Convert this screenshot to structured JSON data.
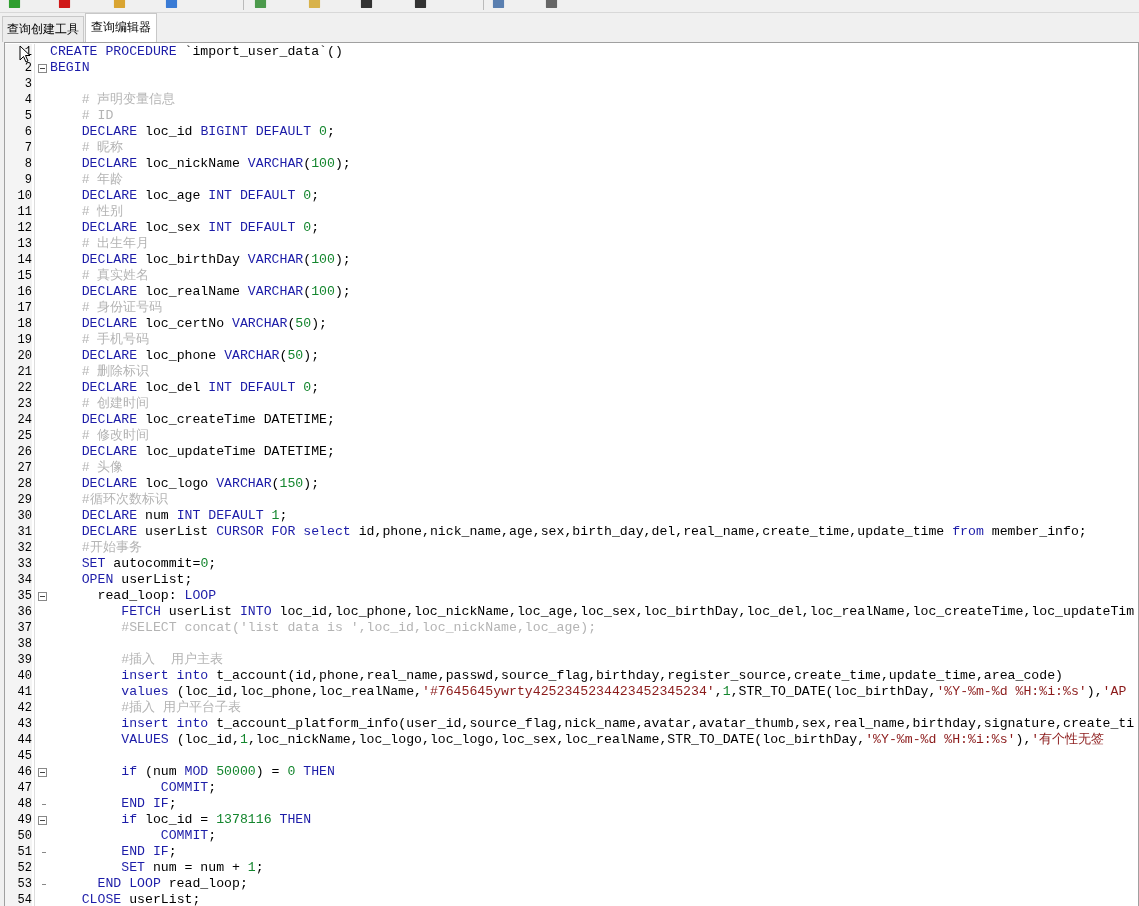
{
  "tabs": [
    {
      "label": "查询创建工具",
      "selected": false
    },
    {
      "label": "查询编辑器",
      "selected": true
    }
  ],
  "editor": {
    "lines": [
      {
        "no": "1",
        "parts": [
          {
            "kind": "kw",
            "text": "CREATE PROCEDURE"
          },
          {
            "kind": "id",
            "text": " `import_user_data`()"
          }
        ]
      },
      {
        "no": "2",
        "expanded": true,
        "parts": [
          {
            "kind": "kw",
            "text": "BEGIN"
          }
        ]
      },
      {
        "no": "3"
      },
      {
        "no": "4",
        "parts": [
          {
            "kind": "cmt",
            "text": "    # 声明变量信息"
          }
        ]
      },
      {
        "no": "5",
        "parts": [
          {
            "kind": "cmt",
            "text": "    # ID"
          }
        ]
      },
      {
        "no": "6",
        "parts": [
          {
            "kind": "kw",
            "text": "    DECLARE"
          },
          {
            "kind": "id",
            "text": " loc_id "
          },
          {
            "kind": "kw",
            "text": "BIGINT DEFAULT"
          },
          {
            "kind": "num",
            "text": " 0"
          },
          {
            "kind": "id",
            "text": ";"
          }
        ]
      },
      {
        "no": "7",
        "parts": [
          {
            "kind": "cmt",
            "text": "    # 昵称"
          }
        ]
      },
      {
        "no": "8",
        "parts": [
          {
            "kind": "kw",
            "text": "    DECLARE"
          },
          {
            "kind": "id",
            "text": " loc_nickName "
          },
          {
            "kind": "kw",
            "text": "VARCHAR"
          },
          {
            "kind": "id",
            "text": "("
          },
          {
            "kind": "num",
            "text": "100"
          },
          {
            "kind": "id",
            "text": ");"
          }
        ]
      },
      {
        "no": "9",
        "parts": [
          {
            "kind": "cmt",
            "text": "    # 年龄"
          }
        ]
      },
      {
        "no": "10",
        "parts": [
          {
            "kind": "kw",
            "text": "    DECLARE"
          },
          {
            "kind": "id",
            "text": " loc_age "
          },
          {
            "kind": "kw",
            "text": "INT DEFAULT"
          },
          {
            "kind": "num",
            "text": " 0"
          },
          {
            "kind": "id",
            "text": ";"
          }
        ]
      },
      {
        "no": "11",
        "parts": [
          {
            "kind": "cmt",
            "text": "    # 性别"
          }
        ]
      },
      {
        "no": "12",
        "parts": [
          {
            "kind": "kw",
            "text": "    DECLARE"
          },
          {
            "kind": "id",
            "text": " loc_sex "
          },
          {
            "kind": "kw",
            "text": "INT DEFAULT"
          },
          {
            "kind": "num",
            "text": " 0"
          },
          {
            "kind": "id",
            "text": ";"
          }
        ]
      },
      {
        "no": "13",
        "parts": [
          {
            "kind": "cmt",
            "text": "    # 出生年月"
          }
        ]
      },
      {
        "no": "14",
        "parts": [
          {
            "kind": "kw",
            "text": "    DECLARE"
          },
          {
            "kind": "id",
            "text": " loc_birthDay "
          },
          {
            "kind": "kw",
            "text": "VARCHAR"
          },
          {
            "kind": "id",
            "text": "("
          },
          {
            "kind": "num",
            "text": "100"
          },
          {
            "kind": "id",
            "text": ");"
          }
        ]
      },
      {
        "no": "15",
        "parts": [
          {
            "kind": "cmt",
            "text": "    # 真实姓名"
          }
        ]
      },
      {
        "no": "16",
        "parts": [
          {
            "kind": "kw",
            "text": "    DECLARE"
          },
          {
            "kind": "id",
            "text": " loc_realName "
          },
          {
            "kind": "kw",
            "text": "VARCHAR"
          },
          {
            "kind": "id",
            "text": "("
          },
          {
            "kind": "num",
            "text": "100"
          },
          {
            "kind": "id",
            "text": ");"
          }
        ]
      },
      {
        "no": "17",
        "parts": [
          {
            "kind": "cmt",
            "text": "    # 身份证号码"
          }
        ]
      },
      {
        "no": "18",
        "parts": [
          {
            "kind": "kw",
            "text": "    DECLARE"
          },
          {
            "kind": "id",
            "text": " loc_certNo "
          },
          {
            "kind": "kw",
            "text": "VARCHAR"
          },
          {
            "kind": "id",
            "text": "("
          },
          {
            "kind": "num",
            "text": "50"
          },
          {
            "kind": "id",
            "text": ");"
          }
        ]
      },
      {
        "no": "19",
        "parts": [
          {
            "kind": "cmt",
            "text": "    # 手机号码"
          }
        ]
      },
      {
        "no": "20",
        "parts": [
          {
            "kind": "kw",
            "text": "    DECLARE"
          },
          {
            "kind": "id",
            "text": " loc_phone "
          },
          {
            "kind": "kw",
            "text": "VARCHAR"
          },
          {
            "kind": "id",
            "text": "("
          },
          {
            "kind": "num",
            "text": "50"
          },
          {
            "kind": "id",
            "text": ");"
          }
        ]
      },
      {
        "no": "21",
        "parts": [
          {
            "kind": "cmt",
            "text": "    # 删除标识"
          }
        ]
      },
      {
        "no": "22",
        "parts": [
          {
            "kind": "kw",
            "text": "    DECLARE"
          },
          {
            "kind": "id",
            "text": " loc_del "
          },
          {
            "kind": "kw",
            "text": "INT DEFAULT"
          },
          {
            "kind": "num",
            "text": " 0"
          },
          {
            "kind": "id",
            "text": ";"
          }
        ]
      },
      {
        "no": "23",
        "parts": [
          {
            "kind": "cmt",
            "text": "    # 创建时间"
          }
        ]
      },
      {
        "no": "24",
        "parts": [
          {
            "kind": "kw",
            "text": "    DECLARE"
          },
          {
            "kind": "id",
            "text": " loc_createTime DATETIME;"
          }
        ]
      },
      {
        "no": "25",
        "parts": [
          {
            "kind": "cmt",
            "text": "    # 修改时间"
          }
        ]
      },
      {
        "no": "26",
        "parts": [
          {
            "kind": "kw",
            "text": "    DECLARE"
          },
          {
            "kind": "id",
            "text": " loc_updateTime DATETIME;"
          }
        ]
      },
      {
        "no": "27",
        "parts": [
          {
            "kind": "cmt",
            "text": "    # 头像"
          }
        ]
      },
      {
        "no": "28",
        "parts": [
          {
            "kind": "kw",
            "text": "    DECLARE"
          },
          {
            "kind": "id",
            "text": " loc_logo "
          },
          {
            "kind": "kw",
            "text": "VARCHAR"
          },
          {
            "kind": "id",
            "text": "("
          },
          {
            "kind": "num",
            "text": "150"
          },
          {
            "kind": "id",
            "text": ");"
          }
        ]
      },
      {
        "no": "29",
        "parts": [
          {
            "kind": "cmt",
            "text": "    #循环次数标识"
          }
        ]
      },
      {
        "no": "30",
        "parts": [
          {
            "kind": "kw",
            "text": "    DECLARE"
          },
          {
            "kind": "id",
            "text": " num "
          },
          {
            "kind": "kw",
            "text": "INT DEFAULT"
          },
          {
            "kind": "num",
            "text": " 1"
          },
          {
            "kind": "id",
            "text": ";"
          }
        ]
      },
      {
        "no": "31",
        "parts": [
          {
            "kind": "kw",
            "text": "    DECLARE"
          },
          {
            "kind": "id",
            "text": " userList "
          },
          {
            "kind": "kw",
            "text": "CURSOR FOR select"
          },
          {
            "kind": "id",
            "text": " id,phone,nick_name,age,sex,birth_day,del,real_name,create_time,update_time "
          },
          {
            "kind": "kw",
            "text": "from"
          },
          {
            "kind": "id",
            "text": " member_info;"
          }
        ]
      },
      {
        "no": "32",
        "parts": [
          {
            "kind": "cmt",
            "text": "    #开始事务"
          }
        ]
      },
      {
        "no": "33",
        "parts": [
          {
            "kind": "kw",
            "text": "    SET"
          },
          {
            "kind": "id",
            "text": " autocommit="
          },
          {
            "kind": "num",
            "text": "0"
          },
          {
            "kind": "id",
            "text": ";"
          }
        ]
      },
      {
        "no": "34",
        "parts": [
          {
            "kind": "kw",
            "text": "    OPEN"
          },
          {
            "kind": "id",
            "text": " userList;"
          }
        ]
      },
      {
        "no": "35",
        "expanded": true,
        "parts": [
          {
            "kind": "id",
            "text": "      read_loop: "
          },
          {
            "kind": "kw",
            "text": "LOOP"
          }
        ]
      },
      {
        "no": "36",
        "parts": [
          {
            "kind": "kw",
            "text": "         FETCH"
          },
          {
            "kind": "id",
            "text": " userList "
          },
          {
            "kind": "kw",
            "text": "INTO"
          },
          {
            "kind": "id",
            "text": " loc_id,loc_phone,loc_nickName,loc_age,loc_sex,loc_birthDay,loc_del,loc_realName,loc_createTime,loc_updateTim"
          }
        ]
      },
      {
        "no": "37",
        "parts": [
          {
            "kind": "cmt",
            "text": "         #SELECT concat('list data is ',loc_id,loc_nickName,loc_age);"
          }
        ]
      },
      {
        "no": "38"
      },
      {
        "no": "39",
        "parts": [
          {
            "kind": "cmt",
            "text": "         #插入  用户主表"
          }
        ]
      },
      {
        "no": "40",
        "parts": [
          {
            "kind": "kw",
            "text": "         insert into"
          },
          {
            "kind": "id",
            "text": " t_account(id,phone,real_name,passwd,source_flag,birthday,register_source,create_time,update_time,area_code)"
          }
        ]
      },
      {
        "no": "41",
        "parts": [
          {
            "kind": "kw",
            "text": "         values"
          },
          {
            "kind": "id",
            "text": " (loc_id,loc_phone,loc_realName,"
          },
          {
            "kind": "str",
            "text": "'#7645645ywrty4252345234423452345234'"
          },
          {
            "kind": "id",
            "text": ","
          },
          {
            "kind": "num",
            "text": "1"
          },
          {
            "kind": "id",
            "text": ",STR_TO_DATE(loc_birthDay,"
          },
          {
            "kind": "str",
            "text": "'%Y-%m-%d %H:%i:%s'"
          },
          {
            "kind": "id",
            "text": "),"
          },
          {
            "kind": "str",
            "text": "'AP"
          }
        ]
      },
      {
        "no": "42",
        "parts": [
          {
            "kind": "cmt",
            "text": "         #插入 用户平台子表"
          }
        ]
      },
      {
        "no": "43",
        "parts": [
          {
            "kind": "kw",
            "text": "         insert into"
          },
          {
            "kind": "id",
            "text": " t_account_platform_info(user_id,source_flag,nick_name,avatar,avatar_thumb,sex,real_name,birthday,signature,create_ti"
          }
        ]
      },
      {
        "no": "44",
        "parts": [
          {
            "kind": "kw",
            "text": "         VALUES"
          },
          {
            "kind": "id",
            "text": " (loc_id,"
          },
          {
            "kind": "num",
            "text": "1"
          },
          {
            "kind": "id",
            "text": ",loc_nickName,loc_logo,loc_logo,loc_sex,loc_realName,STR_TO_DATE(loc_birthDay,"
          },
          {
            "kind": "str",
            "text": "'%Y-%m-%d %H:%i:%s'"
          },
          {
            "kind": "id",
            "text": "),"
          },
          {
            "kind": "str",
            "text": "'有个性无签"
          }
        ]
      },
      {
        "no": "45"
      },
      {
        "no": "46",
        "expanded": true,
        "parts": [
          {
            "kind": "kw",
            "text": "         if"
          },
          {
            "kind": "id",
            "text": " (num "
          },
          {
            "kind": "kw",
            "text": "MOD"
          },
          {
            "kind": "num",
            "text": " 50000"
          },
          {
            "kind": "id",
            "text": ") = "
          },
          {
            "kind": "num",
            "text": "0"
          },
          {
            "kind": "kw",
            "text": " THEN"
          }
        ]
      },
      {
        "no": "47",
        "parts": [
          {
            "kind": "kw",
            "text": "              COMMIT"
          },
          {
            "kind": "id",
            "text": ";"
          }
        ]
      },
      {
        "no": "48",
        "block_end": true,
        "parts": [
          {
            "kind": "kw",
            "text": "         END IF"
          },
          {
            "kind": "id",
            "text": ";"
          }
        ]
      },
      {
        "no": "49",
        "expanded": true,
        "parts": [
          {
            "kind": "kw",
            "text": "         if"
          },
          {
            "kind": "id",
            "text": " loc_id = "
          },
          {
            "kind": "num",
            "text": "1378116"
          },
          {
            "kind": "kw",
            "text": " THEN"
          }
        ]
      },
      {
        "no": "50",
        "parts": [
          {
            "kind": "kw",
            "text": "              COMMIT"
          },
          {
            "kind": "id",
            "text": ";"
          }
        ]
      },
      {
        "no": "51",
        "block_end": true,
        "parts": [
          {
            "kind": "kw",
            "text": "         END IF"
          },
          {
            "kind": "id",
            "text": ";"
          }
        ]
      },
      {
        "no": "52",
        "parts": [
          {
            "kind": "kw",
            "text": "         SET"
          },
          {
            "kind": "id",
            "text": " num = num + "
          },
          {
            "kind": "num",
            "text": "1"
          },
          {
            "kind": "id",
            "text": ";"
          }
        ]
      },
      {
        "no": "53",
        "block_end": true,
        "parts": [
          {
            "kind": "kw",
            "text": "      END LOOP"
          },
          {
            "kind": "id",
            "text": " read_loop;"
          }
        ]
      },
      {
        "no": "54",
        "parts": [
          {
            "kind": "kw",
            "text": "    CLOSE"
          },
          {
            "kind": "id",
            "text": " userList;"
          }
        ]
      }
    ]
  }
}
